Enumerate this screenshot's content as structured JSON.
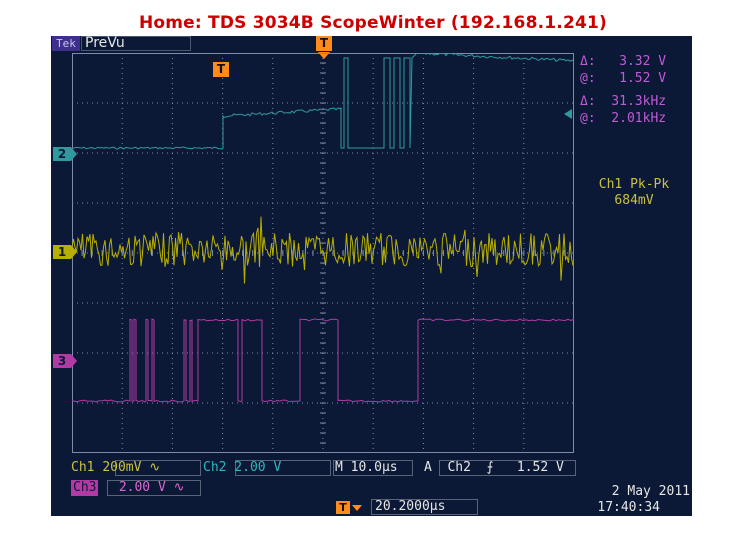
{
  "header": {
    "title": "Home:  TDS 3034B  ScopeWinter  (192.168.1.241)"
  },
  "scope": {
    "badge": "Tek",
    "mode": "PreVu",
    "trigger_marker": "T",
    "channel_markers": {
      "ch2": "2",
      "ch1": "1",
      "ch3": "3"
    },
    "cursors": {
      "voltage_delta": "Δ:   3.32 V",
      "voltage_at": "@:   1.52 V",
      "freq_delta": "Δ:  31.3kHz",
      "freq_at": "@:  2.01kHz"
    },
    "measurement": {
      "label": "Ch1 Pk-Pk",
      "value": "684mV"
    },
    "bottom": {
      "ch1_label": "Ch1",
      "ch1_scale": "200mV ∿",
      "ch2_label": "Ch2",
      "ch2_scale": " 2.00 V",
      "timebase": "M 10.0µs",
      "trigger": "A  Ch2  ⨍   1.52 V",
      "ch3_label": "Ch3",
      "ch3_scale": " 2.00 V ∿",
      "delay": "20.2000µs",
      "date": "2 May 2011",
      "time": "17:40:34"
    },
    "colors": {
      "background": "#0c1936",
      "ch1": "#b8b000",
      "ch2": "#2f9a9e",
      "ch3": "#b13aa4",
      "trigger": "#ff8c1a",
      "cursor": "#c05bd6",
      "grid": "#7d8cae"
    },
    "traces": {
      "ch2_levels": [
        "low",
        "high",
        "high",
        "pulses",
        "high"
      ],
      "ch1": "noise",
      "ch3": "digital-burst"
    }
  }
}
